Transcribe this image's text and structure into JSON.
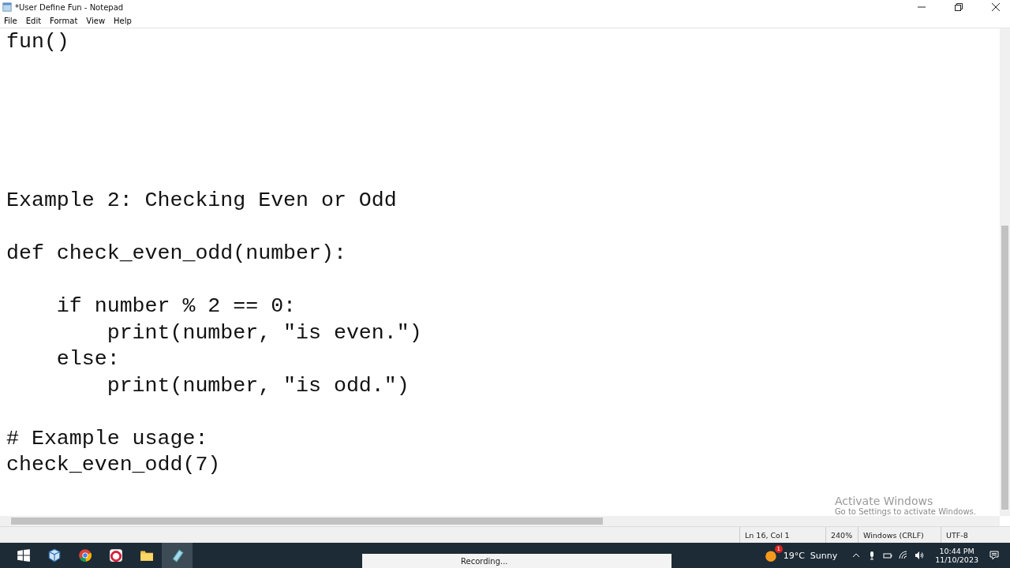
{
  "window": {
    "title": "*User Define Fun - Notepad"
  },
  "menu": [
    "File",
    "Edit",
    "Format",
    "View",
    "Help"
  ],
  "editor": {
    "lines": [
      {
        "kind": "text",
        "text": "fun()"
      },
      {
        "kind": "blank"
      },
      {
        "kind": "blank"
      },
      {
        "kind": "blank"
      },
      {
        "kind": "blank"
      },
      {
        "kind": "blank"
      },
      {
        "kind": "text",
        "text": "Example 2: Checking Even or Odd"
      },
      {
        "kind": "blank"
      },
      {
        "kind": "text",
        "text": "def check_even_odd(number):"
      },
      {
        "kind": "blank"
      },
      {
        "kind": "text",
        "text": "    if number % 2 == 0:"
      },
      {
        "kind": "text",
        "text": "        print(number, \"is even.\")"
      },
      {
        "kind": "text",
        "text": "    else:"
      },
      {
        "kind": "text",
        "text": "        print(number, \"is odd.\")"
      },
      {
        "kind": "blank"
      },
      {
        "kind": "text",
        "text": "# Example usage:"
      },
      {
        "kind": "text",
        "text": "check_even_odd(7)"
      }
    ]
  },
  "activation": {
    "title": "Activate Windows",
    "subtitle": "Go to Settings to activate Windows."
  },
  "status_bar": {
    "position": "Ln 16, Col 1",
    "zoom": "240%",
    "line_ending": "Windows (CRLF)",
    "encoding": "UTF-8"
  },
  "taskbar": {
    "recording": "Recording...",
    "weather": "19°C  Sunny",
    "weather_badge": "1",
    "time": "10:44 PM",
    "date": "11/10/2023"
  }
}
